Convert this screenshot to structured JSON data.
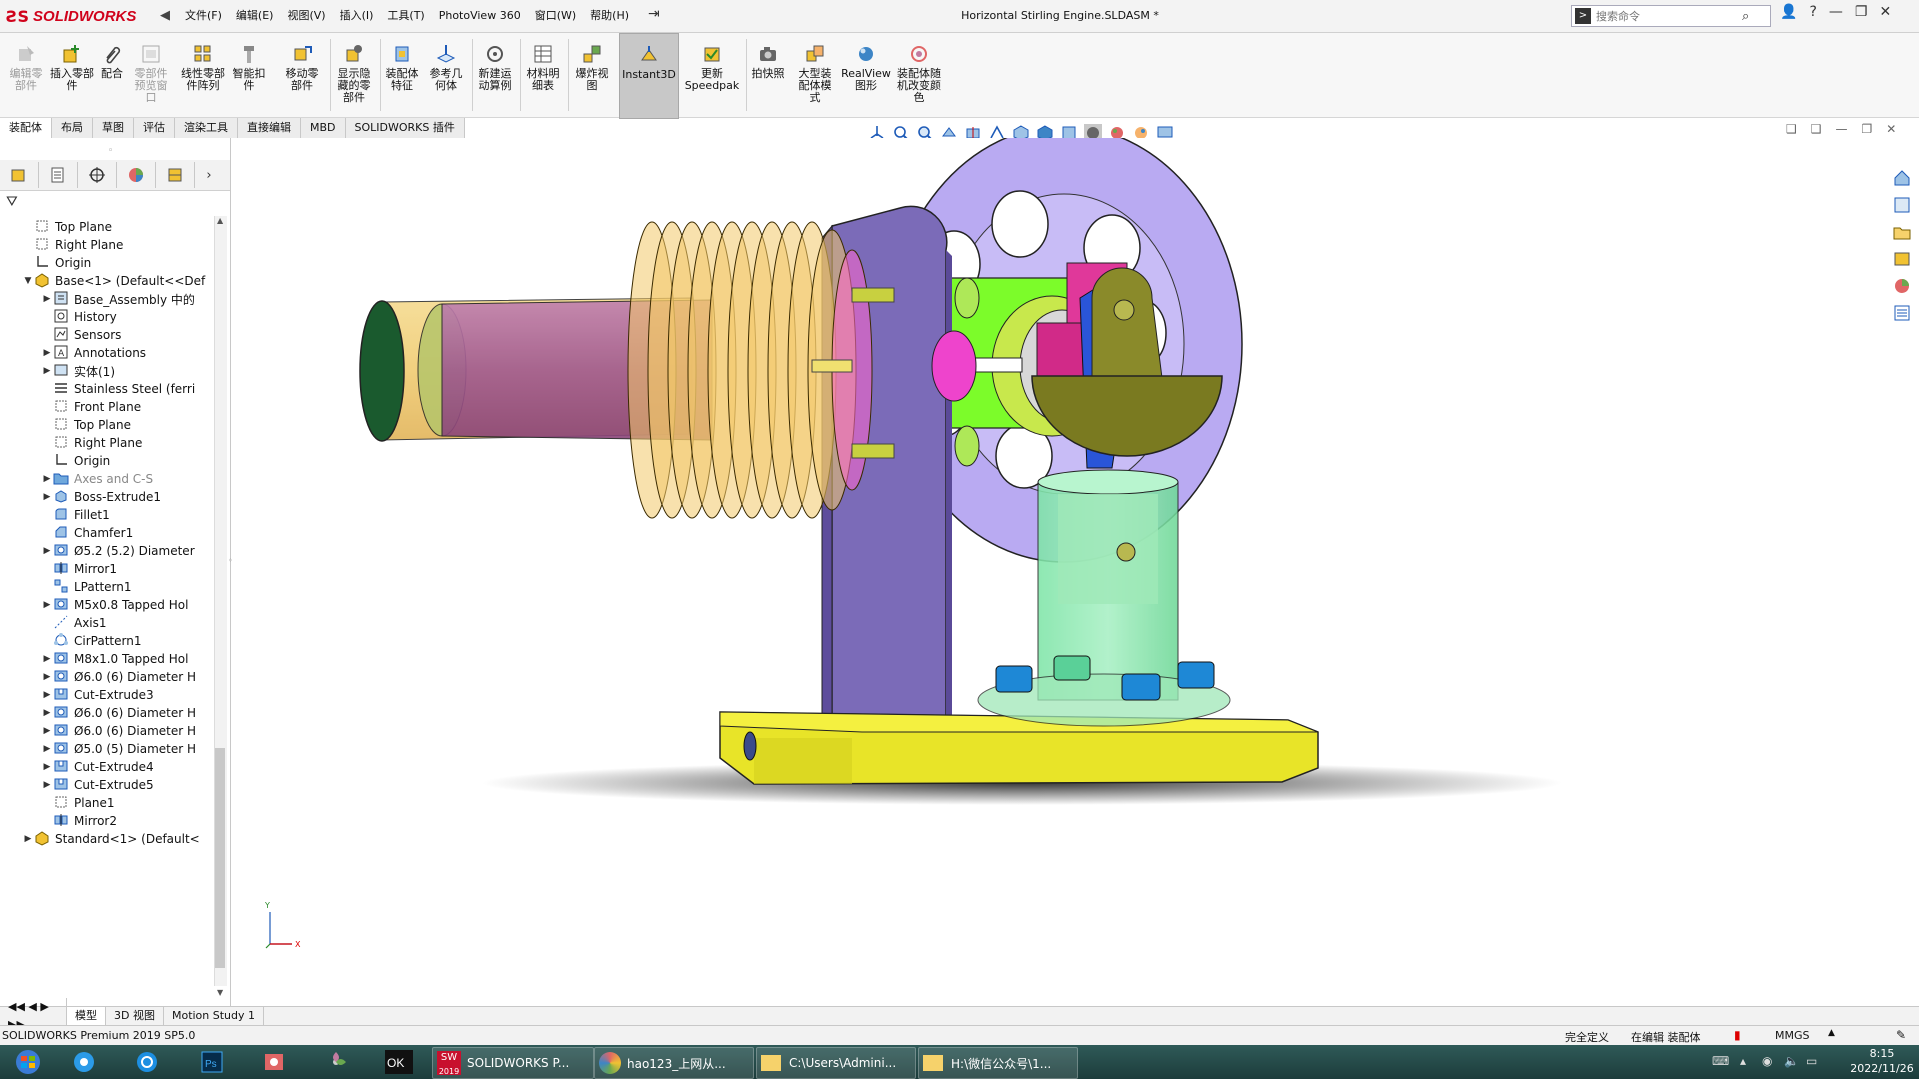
{
  "app": {
    "logo_text": "SOLIDWORKS",
    "document_title": "Horizontal Stirling Engine.SLDASM *",
    "search_placeholder": "搜索命令"
  },
  "menu": [
    "文件(F)",
    "编辑(E)",
    "视图(V)",
    "插入(I)",
    "工具(T)",
    "PhotoView 360",
    "窗口(W)",
    "帮助(H)"
  ],
  "ribbon": {
    "buttons": [
      {
        "label": "编辑零部件",
        "dim": true
      },
      {
        "label": "插入零部件"
      },
      {
        "label": "配合"
      },
      {
        "label": "零部件预览窗口",
        "dim": true
      },
      {
        "label": "线性零部件阵列"
      },
      {
        "label": "智能扣件"
      },
      {
        "label": "移动零部件"
      },
      {
        "label": "显示隐藏的零部件"
      },
      {
        "label": "装配体特征"
      },
      {
        "label": "参考几何体"
      },
      {
        "label": "新建运动算例"
      },
      {
        "label": "材料明细表"
      },
      {
        "label": "爆炸视图"
      },
      {
        "label": "Instant3D"
      },
      {
        "label": "更新Speedpak"
      },
      {
        "label": "拍快照"
      },
      {
        "label": "大型装配体模式"
      },
      {
        "label": "RealView图形"
      },
      {
        "label": "装配体随机改变颜色"
      }
    ]
  },
  "tabs": [
    "装配体",
    "布局",
    "草图",
    "评估",
    "渲染工具",
    "直接编辑",
    "MBD",
    "SOLIDWORKS 插件"
  ],
  "tree": [
    {
      "label": "Top Plane",
      "icon": "plane-icon",
      "indent": 0,
      "exp": ""
    },
    {
      "label": "Right Plane",
      "icon": "plane-icon",
      "indent": 0,
      "exp": ""
    },
    {
      "label": "Origin",
      "icon": "origin-icon",
      "indent": 0,
      "exp": ""
    },
    {
      "label": "Base<1> (Default<<Def",
      "icon": "part-icon",
      "indent": 0,
      "exp": "▼"
    },
    {
      "label": "Base_Assembly 中的",
      "icon": "folder-icon",
      "indent": 1,
      "exp": "▶"
    },
    {
      "label": "History",
      "icon": "history-icon",
      "indent": 1,
      "exp": ""
    },
    {
      "label": "Sensors",
      "icon": "sensor-icon",
      "indent": 1,
      "exp": ""
    },
    {
      "label": "Annotations",
      "icon": "annotation-icon",
      "indent": 1,
      "exp": "▶"
    },
    {
      "label": "实体(1)",
      "icon": "solid-body-icon",
      "indent": 1,
      "exp": "▶"
    },
    {
      "label": "Stainless Steel (ferri",
      "icon": "material-icon",
      "indent": 1,
      "exp": ""
    },
    {
      "label": "Front Plane",
      "icon": "plane-icon",
      "indent": 1,
      "exp": ""
    },
    {
      "label": "Top Plane",
      "icon": "plane-icon",
      "indent": 1,
      "exp": ""
    },
    {
      "label": "Right Plane",
      "icon": "plane-icon",
      "indent": 1,
      "exp": ""
    },
    {
      "label": "Origin",
      "icon": "origin-icon",
      "indent": 1,
      "exp": ""
    },
    {
      "label": "Axes and C-S",
      "icon": "folder-lock-icon",
      "indent": 1,
      "exp": "▶",
      "grey": true
    },
    {
      "label": "Boss-Extrude1",
      "icon": "extrude-icon",
      "indent": 1,
      "exp": "▶"
    },
    {
      "label": "Fillet1",
      "icon": "fillet-icon",
      "indent": 1,
      "exp": ""
    },
    {
      "label": "Chamfer1",
      "icon": "chamfer-icon",
      "indent": 1,
      "exp": ""
    },
    {
      "label": "Ø5.2 (5.2) Diameter",
      "icon": "hole-icon",
      "indent": 1,
      "exp": "▶"
    },
    {
      "label": "Mirror1",
      "icon": "mirror-icon",
      "indent": 1,
      "exp": ""
    },
    {
      "label": "LPattern1",
      "icon": "linear-pattern-icon",
      "indent": 1,
      "exp": ""
    },
    {
      "label": "M5x0.8 Tapped Hol",
      "icon": "hole-icon",
      "indent": 1,
      "exp": "▶"
    },
    {
      "label": "Axis1",
      "icon": "axis-icon",
      "indent": 1,
      "exp": ""
    },
    {
      "label": "CirPattern1",
      "icon": "circular-pattern-icon",
      "indent": 1,
      "exp": ""
    },
    {
      "label": "M8x1.0 Tapped Hol",
      "icon": "hole-icon",
      "indent": 1,
      "exp": "▶"
    },
    {
      "label": "Ø6.0 (6) Diameter H",
      "icon": "hole-icon",
      "indent": 1,
      "exp": "▶"
    },
    {
      "label": "Cut-Extrude3",
      "icon": "cut-extrude-icon",
      "indent": 1,
      "exp": "▶"
    },
    {
      "label": "Ø6.0 (6) Diameter H",
      "icon": "hole-icon",
      "indent": 1,
      "exp": "▶"
    },
    {
      "label": "Ø6.0 (6) Diameter H",
      "icon": "hole-icon",
      "indent": 1,
      "exp": "▶"
    },
    {
      "label": "Ø5.0 (5) Diameter H",
      "icon": "hole-icon",
      "indent": 1,
      "exp": "▶"
    },
    {
      "label": "Cut-Extrude4",
      "icon": "cut-extrude-icon",
      "indent": 1,
      "exp": "▶"
    },
    {
      "label": "Cut-Extrude5",
      "icon": "cut-extrude-icon",
      "indent": 1,
      "exp": "▶"
    },
    {
      "label": "Plane1",
      "icon": "plane-icon",
      "indent": 1,
      "exp": ""
    },
    {
      "label": "Mirror2",
      "icon": "mirror-icon",
      "indent": 1,
      "exp": ""
    },
    {
      "label": "Standard<1> (Default<",
      "icon": "part-icon",
      "indent": 0,
      "exp": "▶"
    }
  ],
  "bottom_tabs": [
    "模型",
    "3D 视图",
    "Motion Study 1"
  ],
  "status": {
    "left": "SOLIDWORKS Premium 2019 SP5.0",
    "defined": "完全定义",
    "editing": "在编辑 装配体",
    "units": "MMGS"
  },
  "taskbar": {
    "apps": [
      "SOLIDWORKS P...",
      "hao123_上网从...",
      "C:\\Users\\Admini...",
      "H:\\微信公众号\\1..."
    ],
    "badge": "2019",
    "time": "8:15",
    "date": "2022/11/26"
  },
  "axis_labels": {
    "x": "X",
    "y": "Y"
  }
}
